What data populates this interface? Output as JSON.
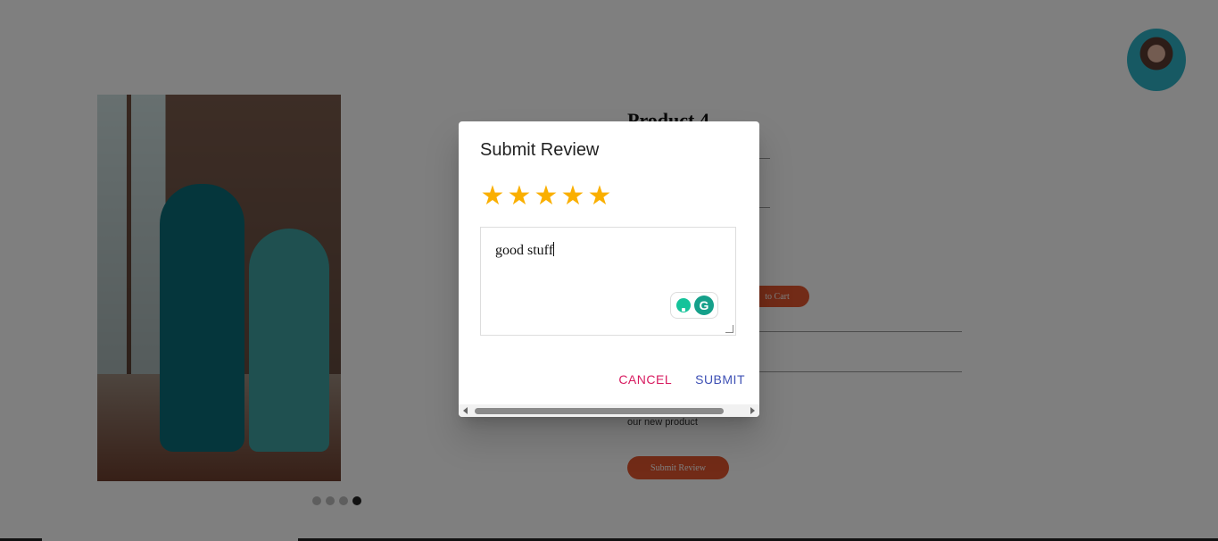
{
  "product": {
    "title": "Product 4",
    "meta": "",
    "add_to_cart_label": "to Cart",
    "description": "our new product",
    "submit_review_label": "Submit Review"
  },
  "carousel": {
    "slides": 4,
    "active_index": 4
  },
  "dialog": {
    "title": "Submit Review",
    "rating": 5,
    "rating_max": 5,
    "review_text": "good stuff",
    "cancel_label": "CANCEL",
    "submit_label": "SUBMIT",
    "star_color": "#faaf00"
  },
  "colors": {
    "accent_orange": "#e4572e",
    "cancel_color": "#d81b60",
    "submit_color": "#3f51b5"
  }
}
